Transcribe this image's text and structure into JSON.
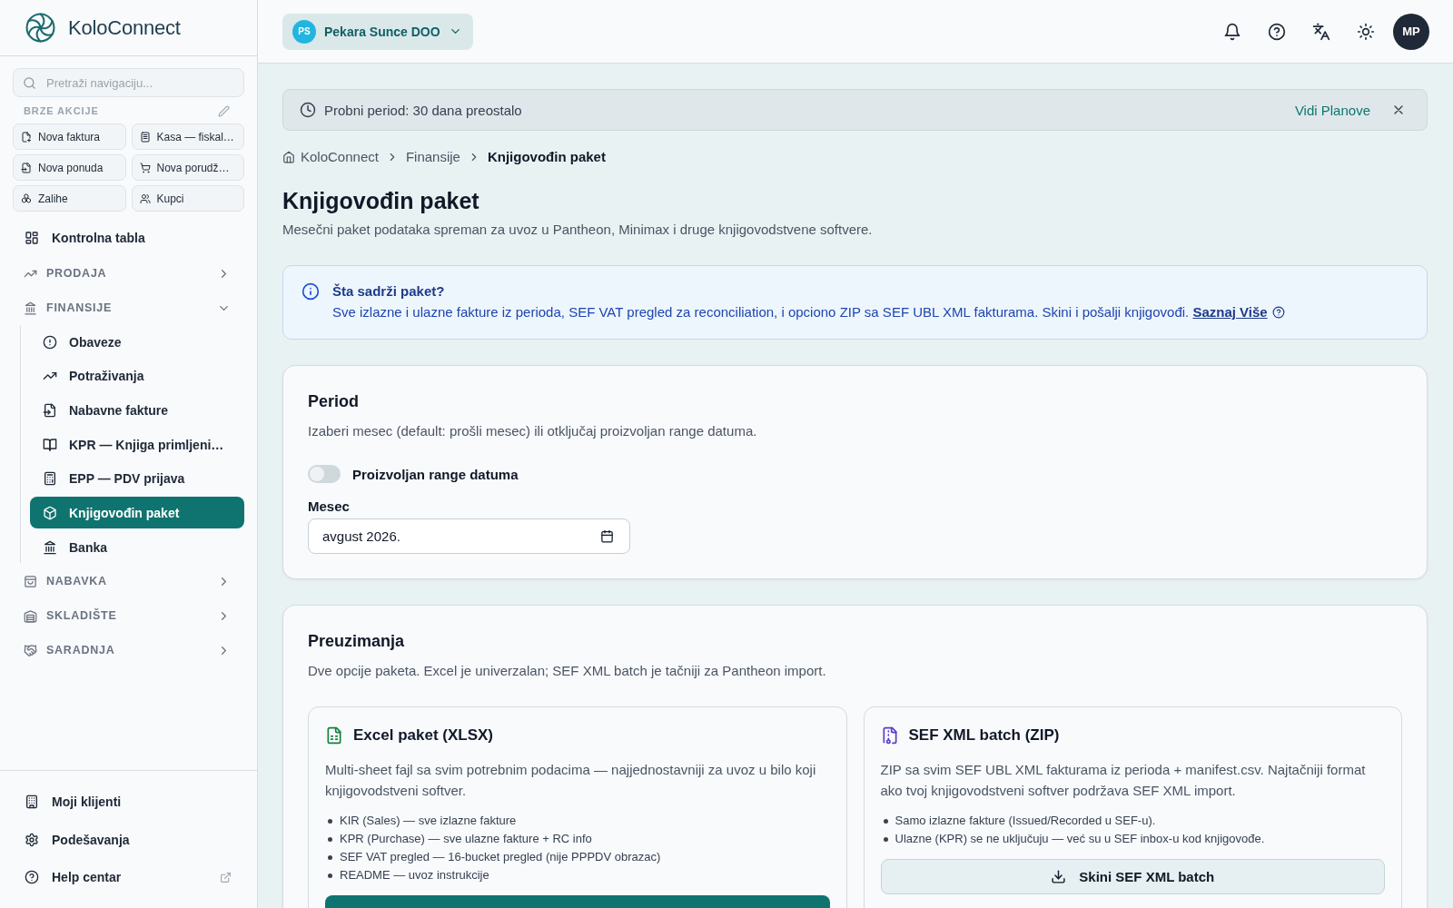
{
  "sidebar": {
    "logo_text": "KoloConnect",
    "search": {
      "placeholder": "Pretraži navigaciju..."
    },
    "quick_actions": {
      "title": "BRZE AKCIJE",
      "items": [
        "Nova faktura",
        "Kasa — fiskal…",
        "Nova ponuda",
        "Nova porudž…",
        "Zalihe",
        "Kupci"
      ]
    },
    "nav": [
      {
        "kind": "link",
        "label": "Kontrolna tabla",
        "selected": false
      },
      {
        "kind": "section",
        "label": "PRODAJA",
        "expanded": false
      },
      {
        "kind": "section",
        "label": "FINANSIJE",
        "expanded": true,
        "children": [
          {
            "label": "Obaveze",
            "selected": false
          },
          {
            "label": "Potraživanja",
            "selected": false
          },
          {
            "label": "Nabavne fakture",
            "selected": false
          },
          {
            "label": "KPR — Knjiga primljeni…",
            "selected": false
          },
          {
            "label": "EPP — PDV prijava",
            "selected": false
          },
          {
            "label": "Knjigovođin paket",
            "selected": true
          },
          {
            "label": "Banka",
            "selected": false
          }
        ]
      },
      {
        "kind": "section",
        "label": "NABAVKA",
        "expanded": false
      },
      {
        "kind": "section",
        "label": "SKLADIŠTE",
        "expanded": false
      },
      {
        "kind": "section",
        "label": "SARADNJA",
        "expanded": false
      }
    ],
    "footer": [
      {
        "label": "Moji klijenti",
        "external": false
      },
      {
        "label": "Podešavanja",
        "external": false
      },
      {
        "label": "Help centar",
        "external": true
      }
    ]
  },
  "header": {
    "company": {
      "initials": "PS",
      "name": "Pekara Sunce DOO"
    },
    "user": {
      "initials": "MP"
    }
  },
  "trial_banner": {
    "text": "Probni period: 30 dana preostalo",
    "link": "Vidi Planove"
  },
  "breadcrumb": [
    {
      "label": "KoloConnect",
      "current": false
    },
    {
      "label": "Finansije",
      "current": false
    },
    {
      "label": "Knjigovođin paket",
      "current": true
    }
  ],
  "page": {
    "title": "Knjigovođin paket",
    "subtitle": "Mesečni paket podataka spreman za uvoz u Pantheon, Minimax i druge knjigovodstvene softvere."
  },
  "info": {
    "title": "Šta sadrži paket?",
    "text": "Sve izlazne i ulazne fakture iz perioda, SEF VAT pregled za reconciliation, i opciono ZIP sa SEF UBL XML fakturama. Skini i pošalji knjigovođi.",
    "link": "Saznaj Više"
  },
  "period": {
    "title": "Period",
    "description": "Izaberi mesec (default: prošli mesec) ili otključaj proizvoljan range datuma.",
    "toggle": {
      "label": "Proizvoljan range datuma",
      "on": false
    },
    "month": {
      "label": "Mesec",
      "value": "avgust 2026."
    }
  },
  "downloads": {
    "title": "Preuzimanja",
    "description": "Dve opcije paketa. Excel je univerzalan; SEF XML batch je tačniji za Pantheon import.",
    "options": [
      {
        "title": "Excel paket (XLSX)",
        "description": "Multi-sheet fajl sa svim potrebnim podacima — najjednostavniji za uvoz u bilo koji knjigovodstveni softver.",
        "bullets": [
          "KIR (Sales) — sve izlazne fakture",
          "KPR (Purchase) — sve ulazne fakture + RC info",
          "SEF VAT pregled — 16-bucket pregled (nije PPPDV obrazac)",
          "README — uvoz instrukcije"
        ],
        "button": {
          "kind": "primary"
        }
      },
      {
        "title": "SEF XML batch (ZIP)",
        "description": "ZIP sa svim SEF UBL XML fakturama iz perioda + manifest.csv. Najtačniji format ako tvoj knjigovodstveni softver podržava SEF XML import.",
        "bullets": [
          "Samo izlazne fakture (Issued/Recorded u SEF-u).",
          "Ulazne (KPR) se ne uključuju — već su u SEF inbox-u kod knjigovođe."
        ],
        "button": {
          "kind": "secondary",
          "label": "Skini SEF XML batch"
        }
      }
    ]
  }
}
